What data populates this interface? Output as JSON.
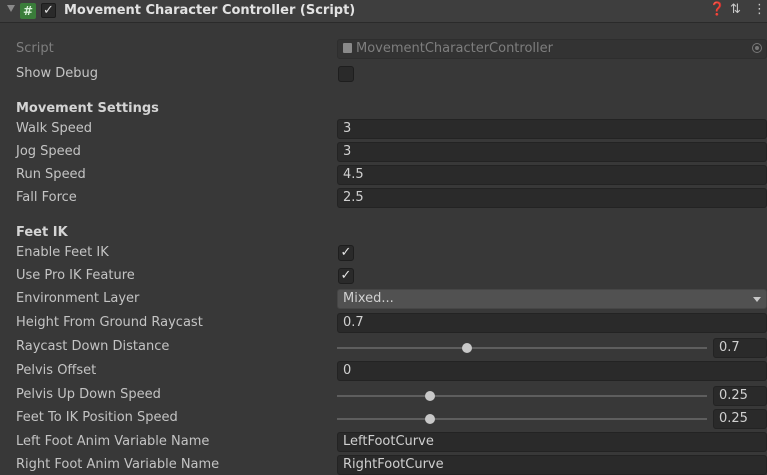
{
  "header": {
    "title": "Movement Character Controller (Script)",
    "enabled": true,
    "script_icon_glyph": "#"
  },
  "script_row": {
    "label": "Script",
    "value": "MovementCharacterController"
  },
  "show_debug": {
    "label": "Show Debug",
    "checked": false
  },
  "movement_settings": {
    "heading": "Movement Settings",
    "walk_speed": {
      "label": "Walk Speed",
      "value": "3"
    },
    "jog_speed": {
      "label": "Jog Speed",
      "value": "3"
    },
    "run_speed": {
      "label": "Run Speed",
      "value": "4.5"
    },
    "fall_force": {
      "label": "Fall Force",
      "value": "2.5"
    }
  },
  "feet_ik": {
    "heading": "Feet IK",
    "enable_feet_ik": {
      "label": "Enable Feet IK",
      "checked": true
    },
    "use_pro_ik": {
      "label": "Use Pro IK Feature",
      "checked": true
    },
    "environment_layer": {
      "label": "Environment Layer",
      "value": "Mixed..."
    },
    "height_from_ground": {
      "label": "Height From Ground Raycast",
      "value": "0.7"
    },
    "raycast_down_distance": {
      "label": "Raycast Down Distance",
      "value": "0.7",
      "slider_fraction": 0.35
    },
    "pelvis_offset": {
      "label": "Pelvis Offset",
      "value": "0"
    },
    "pelvis_up_down_speed": {
      "label": "Pelvis Up Down Speed",
      "value": "0.25",
      "slider_fraction": 0.25
    },
    "feet_to_ik_speed": {
      "label": "Feet To IK Position Speed",
      "value": "0.25",
      "slider_fraction": 0.25
    },
    "left_foot_var": {
      "label": "Left Foot Anim Variable Name",
      "value": "LeftFootCurve"
    },
    "right_foot_var": {
      "label": "Right Foot Anim Variable Name",
      "value": "RightFootCurve"
    }
  },
  "colors": {
    "background": "#383838",
    "field": "#2a2a2a",
    "script_icon": "#3a7d3a"
  }
}
